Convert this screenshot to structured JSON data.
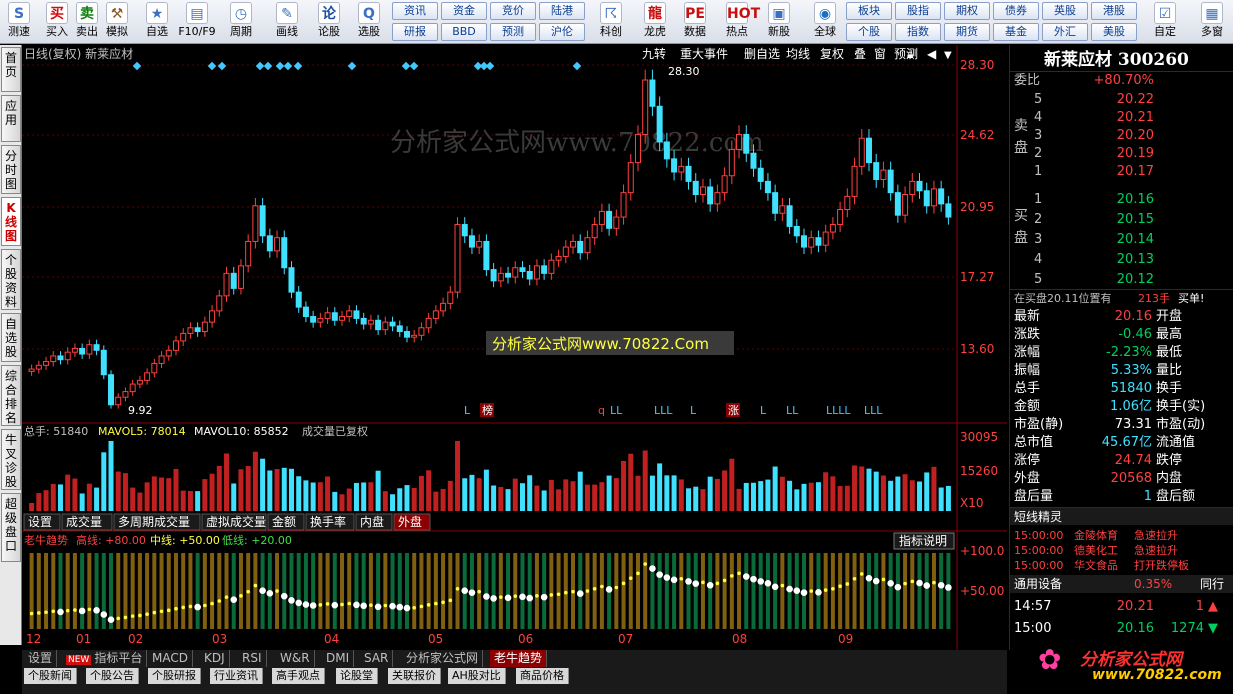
{
  "toolbar": {
    "buttons": [
      {
        "name": "test-button",
        "label": "测速",
        "icon": "S",
        "color": "#3a6fc4"
      },
      {
        "name": "buy-button",
        "label": "买入",
        "icon": "买",
        "color": "#d01010"
      },
      {
        "name": "sell-button",
        "label": "卖出",
        "icon": "卖",
        "color": "#108010"
      },
      {
        "name": "simulate-button",
        "label": "模拟",
        "icon": "⚒",
        "color": "#8a5a20"
      },
      {
        "name": "watchlist-button",
        "label": "自选",
        "icon": "★",
        "color": "#3a6fc4"
      },
      {
        "name": "f10-button",
        "label": "F10/F9",
        "icon": "▤",
        "color": "#3a6fc4"
      },
      {
        "name": "period-button",
        "label": "周期",
        "icon": "◷",
        "color": "#3a6fc4"
      },
      {
        "name": "draw-button",
        "label": "画线",
        "icon": "✎",
        "color": "#3a6fc4"
      },
      {
        "name": "formula-button",
        "label": "论股",
        "icon": "论",
        "color": "#1d4fa0"
      },
      {
        "name": "select-stock-button",
        "label": "选股",
        "icon": "Q",
        "color": "#3a6fc4"
      },
      {
        "name": "school-button",
        "label": "科创",
        "icon": "☈",
        "color": "#3a6fc4"
      },
      {
        "name": "dragon-button",
        "label": "龙虎",
        "icon": "龍",
        "color": "#c81010"
      },
      {
        "name": "data-button",
        "label": "数据",
        "icon": "PE",
        "color": "#c81010"
      },
      {
        "name": "hot-button",
        "label": "热点",
        "icon": "HOT",
        "color": "#c81010"
      },
      {
        "name": "new-stock-button",
        "label": "新股",
        "icon": "▣",
        "color": "#3a6fc4"
      },
      {
        "name": "global-button",
        "label": "全球",
        "icon": "◉",
        "color": "#1d6fc4"
      },
      {
        "name": "custom-button",
        "label": "自定",
        "icon": "☑",
        "color": "#3a6fc4"
      },
      {
        "name": "multiwindow-button",
        "label": "多窗",
        "icon": "▦",
        "color": "#3a6fc4"
      }
    ],
    "grid1": [
      "资讯",
      "资金",
      "竞价",
      "陆港",
      "研报",
      "BBD",
      "预测",
      "沪伦"
    ],
    "grid2": [
      "板块",
      "股指",
      "期权",
      "债券",
      "英股",
      "港股",
      "个股",
      "指数",
      "期货",
      "基金",
      "外汇",
      "美股"
    ]
  },
  "leftnav": [
    {
      "label": "首页",
      "active": false
    },
    {
      "label": "应用",
      "active": false
    },
    {
      "label": "分时图",
      "active": false
    },
    {
      "label": "K线图",
      "active": true
    },
    {
      "label": "个股资料",
      "active": false
    },
    {
      "label": "自选股",
      "active": false
    },
    {
      "label": "综合排名",
      "active": false
    },
    {
      "label": "牛叉诊股",
      "active": false
    },
    {
      "label": "超级盘口",
      "active": false
    }
  ],
  "chart": {
    "header_left": "日线(复权)  新莱应材",
    "header_tabs": [
      "九转",
      "重大事件",
      "删自选",
      "均线",
      "复权",
      "叠",
      "窗",
      "预测"
    ],
    "price_axis": [
      "28.30",
      "24.62",
      "20.95",
      "17.27",
      "13.60"
    ],
    "high_label": "28.30",
    "low_label": "9.92",
    "watermark1": "分析家公式网www.70822.com",
    "watermark2": "分析家公式网www.70822.Com",
    "event_marks": [
      "L",
      "榜",
      "q",
      "LL",
      "LLL",
      "L",
      "涨",
      "L",
      "LL",
      "LLLL",
      "LLL"
    ],
    "vol_header": {
      "zs": "总手: 51840",
      "ma5": "MAVOL5: 78014",
      "ma10": "MAVOL10: 85852",
      "note": "成交量已复权"
    },
    "vol_axis": [
      "30095",
      "15260",
      "X10"
    ],
    "vol_tabs": [
      "设置",
      "成交量",
      "多周期成交量",
      "虚拟成交量",
      "金额",
      "换手率",
      "内盘",
      "外盘"
    ],
    "ind_header": {
      "name": "老牛趋势",
      "high": "高线: +80.00",
      "mid": "中线: +50.00",
      "low": "低线: +20.00",
      "explain": "指标说明"
    },
    "ind_axis": [
      "+100.0",
      "+50.00"
    ],
    "months": [
      "12",
      "01",
      "02",
      "03",
      "04",
      "05",
      "06",
      "07",
      "08",
      "09"
    ]
  },
  "chart_data": {
    "type": "candlestick",
    "title": "新莱应材 日线(复权)",
    "ylim": [
      9.92,
      28.3
    ],
    "closes": [
      12.1,
      12.3,
      12.5,
      12.8,
      12.6,
      13.0,
      13.2,
      12.9,
      13.4,
      13.1,
      11.8,
      10.2,
      10.6,
      10.9,
      11.3,
      11.5,
      11.9,
      12.4,
      12.8,
      13.1,
      13.6,
      14.0,
      14.3,
      14.1,
      14.6,
      15.2,
      16.0,
      17.2,
      16.4,
      17.6,
      18.9,
      20.8,
      19.2,
      18.4,
      19.1,
      17.5,
      16.2,
      15.4,
      14.9,
      14.6,
      14.8,
      15.1,
      14.7,
      14.9,
      15.2,
      14.8,
      14.5,
      14.7,
      14.2,
      14.6,
      14.4,
      14.1,
      13.8,
      13.9,
      14.3,
      14.8,
      15.2,
      15.6,
      16.2,
      19.8,
      19.2,
      18.6,
      18.9,
      17.4,
      16.8,
      17.2,
      17.0,
      17.5,
      17.3,
      16.9,
      17.6,
      17.2,
      17.9,
      18.1,
      18.6,
      18.9,
      18.3,
      19.1,
      19.8,
      20.5,
      19.6,
      20.2,
      21.5,
      23.1,
      24.6,
      27.5,
      26.1,
      24.2,
      23.3,
      22.6,
      22.9,
      22.1,
      21.4,
      21.8,
      20.9,
      21.5,
      22.4,
      23.8,
      24.6,
      23.6,
      22.8,
      22.1,
      21.5,
      20.4,
      20.8,
      19.7,
      19.2,
      18.6,
      19.1,
      18.7,
      19.4,
      19.8,
      20.6,
      21.3,
      22.9,
      24.4,
      23.1,
      22.2,
      22.7,
      21.5,
      20.3,
      21.4,
      22.1,
      21.6,
      20.8,
      21.7,
      20.9,
      20.2
    ]
  },
  "quote": {
    "name": "新莱应材",
    "code": "300260",
    "webi_label": "委比",
    "webi": "+80.70%",
    "sell_label": "卖盘",
    "buy_label": "买盘",
    "sell": [
      {
        "lvl": "5",
        "p": "20.22"
      },
      {
        "lvl": "4",
        "p": "20.21"
      },
      {
        "lvl": "3",
        "p": "20.20"
      },
      {
        "lvl": "2",
        "p": "20.19"
      },
      {
        "lvl": "1",
        "p": "20.17"
      }
    ],
    "buy": [
      {
        "lvl": "1",
        "p": "20.16"
      },
      {
        "lvl": "2",
        "p": "20.15"
      },
      {
        "lvl": "3",
        "p": "20.14"
      },
      {
        "lvl": "4",
        "p": "20.13"
      },
      {
        "lvl": "5",
        "p": "20.12"
      }
    ],
    "order_note": "在买盘20.11位置有",
    "order_qty": "213手",
    "order_tail": "买单!",
    "stats": [
      {
        "l": "最新",
        "v": "20.16",
        "c": "red",
        "r": "开盘"
      },
      {
        "l": "涨跌",
        "v": "-0.46",
        "c": "grn",
        "r": "最高"
      },
      {
        "l": "涨幅",
        "v": "-2.23%",
        "c": "grn",
        "r": "最低"
      },
      {
        "l": "振幅",
        "v": "5.33%",
        "c": "cyan",
        "r": "量比"
      },
      {
        "l": "总手",
        "v": "51840",
        "c": "cyan",
        "r": "换手"
      },
      {
        "l": "金额",
        "v": "1.06亿",
        "c": "cyan",
        "r": "换手(实)"
      },
      {
        "l": "市盈(静)",
        "v": "73.31",
        "c": "wht",
        "r": "市盈(动)"
      },
      {
        "l": "总市值",
        "v": "45.67亿",
        "c": "cyan",
        "r": "流通值"
      },
      {
        "l": "涨停",
        "v": "24.74",
        "c": "red",
        "r": "跌停"
      },
      {
        "l": "外盘",
        "v": "20568",
        "c": "red",
        "r": "内盘"
      },
      {
        "l": "盘后量",
        "v": "1",
        "c": "cyan",
        "r": "盘后额"
      }
    ],
    "flow_title": "短线精灵",
    "flows": [
      {
        "t": "15:00:00",
        "n": "金陵体育",
        "a": "急速拉升"
      },
      {
        "t": "15:00:00",
        "n": "德美化工",
        "a": "急速拉升"
      },
      {
        "t": "15:00:00",
        "n": "华文食品",
        "a": "打开跌停板"
      }
    ],
    "sector": "通用设备",
    "sector_chg": "0.35%",
    "sector_btn": "同行",
    "ticks": [
      {
        "t": "14:57",
        "p": "20.21",
        "v": "1"
      },
      {
        "t": "15:00",
        "p": "20.16",
        "v": "1274"
      }
    ]
  },
  "bottom": {
    "tabs1": [
      "设置",
      "指标平台",
      "MACD",
      "KDJ",
      "RSI",
      "W&R",
      "DMI",
      "SAR",
      "分析家公式网",
      "老牛趋势"
    ],
    "new_badge": "NEW",
    "tabs2": [
      "个股新闻",
      "个股公告",
      "个股研报",
      "行业资讯",
      "高手观点",
      "论股堂",
      "关联报价",
      "AH股对比",
      "商品价格"
    ]
  },
  "logo": {
    "text": "分析家公式网",
    "url": "www.70822.com"
  }
}
